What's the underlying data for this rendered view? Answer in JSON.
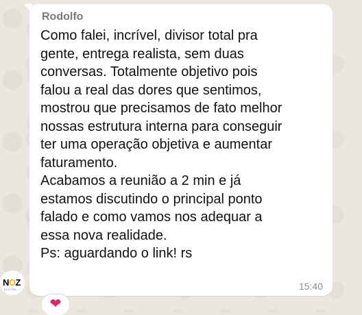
{
  "chat": {
    "sender_name": "Rodolfo",
    "message_lines": [
      "Como falei, incrível, divisor total pra",
      "gente, entrega realista, sem duas",
      "conversas. Totalmente objetivo pois",
      "falou a real das dores que sentimos,",
      "mostrou que precisamos de fato melhor",
      "nossas estrutura interna para conseguir",
      "ter uma operação objetiva e aumentar",
      "faturamento.",
      "Acabamos a reunião a 2 min e já",
      "estamos discutindo o principal ponto",
      "falado e como vamos nos adequar a",
      "essa nova realidade.",
      "Ps: aguardando o link! rs"
    ],
    "timestamp": "15:40",
    "reaction": "❤"
  },
  "avatar": {
    "logo_text_main": "N",
    "logo_text_accent": "O",
    "logo_text_end": "Z",
    "logo_subtext": "DIGITAL"
  },
  "colors": {
    "bubble": "#ffffff",
    "background": "#ece5dd",
    "sender": "#7a7a7a",
    "timestamp": "#8e8e8e",
    "heart": "#e0245e"
  }
}
